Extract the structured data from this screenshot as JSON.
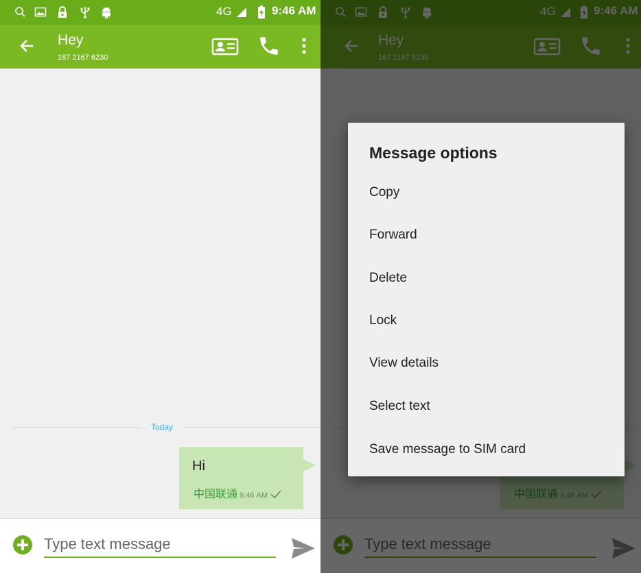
{
  "status_bar": {
    "network": "4G",
    "time": "9:46 AM"
  },
  "app_bar": {
    "title": "Hey",
    "subtitle": "187 2167 6230",
    "icons": [
      "back-arrow-icon",
      "contact-card-icon",
      "phone-icon",
      "more-vert-icon"
    ]
  },
  "conversation": {
    "day_separator": "Today",
    "messages": [
      {
        "text": "Hi",
        "carrier": "中国联通",
        "time": "9:46 AM",
        "status_icon": "check-icon"
      }
    ]
  },
  "compose": {
    "value": "",
    "placeholder": "Type text message",
    "icons": [
      "add-circle-icon",
      "send-icon"
    ]
  },
  "dialog": {
    "title": "Message options",
    "items": [
      "Copy",
      "Forward",
      "Delete",
      "Lock",
      "View details",
      "Select text",
      "Save message to SIM card"
    ]
  },
  "colors": {
    "status_bar": "#6aad1a",
    "app_bar": "#7bb922",
    "bubble": "#c8e6b4",
    "accent": "#6fae1f",
    "background": "#f0f0f0",
    "date_label": "#33b5e5"
  }
}
